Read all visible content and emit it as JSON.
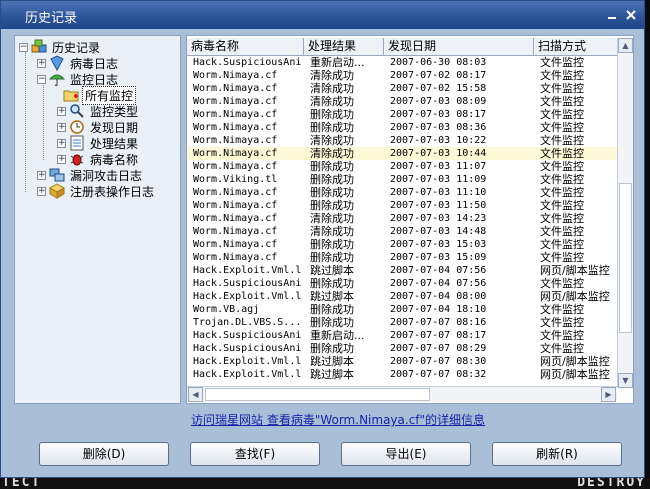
{
  "window": {
    "title": "历史记录"
  },
  "tree": {
    "root": "历史记录",
    "virus_log": "病毒日志",
    "monitor_log": "监控日志",
    "all_monitor": "所有监控",
    "monitor_type": "监控类型",
    "found_date": "发现日期",
    "result": "处理结果",
    "virus_name": "病毒名称",
    "exploit_log": "漏洞攻击日志",
    "registry_log": "注册表操作日志"
  },
  "table": {
    "columns": [
      "病毒名称",
      "处理结果",
      "发现日期",
      "扫描方式"
    ],
    "rows": [
      [
        "Hack.SuspiciousAni",
        "重新启动...",
        "2007-06-30 08:03",
        "文件监控"
      ],
      [
        "Worm.Nimaya.cf",
        "清除成功",
        "2007-07-02 08:17",
        "文件监控"
      ],
      [
        "Worm.Nimaya.cf",
        "清除成功",
        "2007-07-02 15:58",
        "文件监控"
      ],
      [
        "Worm.Nimaya.cf",
        "清除成功",
        "2007-07-03 08:09",
        "文件监控"
      ],
      [
        "Worm.Nimaya.cf",
        "删除成功",
        "2007-07-03 08:17",
        "文件监控"
      ],
      [
        "Worm.Nimaya.cf",
        "删除成功",
        "2007-07-03 08:36",
        "文件监控"
      ],
      [
        "Worm.Nimaya.cf",
        "清除成功",
        "2007-07-03 10:22",
        "文件监控"
      ],
      [
        "Worm.Nimaya.cf",
        "清除成功",
        "2007-07-03 10:44",
        "文件监控"
      ],
      [
        "Worm.Nimaya.cf",
        "删除成功",
        "2007-07-03 11:07",
        "文件监控"
      ],
      [
        "Worm.Viking.tl",
        "删除成功",
        "2007-07-03 11:09",
        "文件监控"
      ],
      [
        "Worm.Nimaya.cf",
        "删除成功",
        "2007-07-03 11:10",
        "文件监控"
      ],
      [
        "Worm.Nimaya.cf",
        "删除成功",
        "2007-07-03 11:50",
        "文件监控"
      ],
      [
        "Worm.Nimaya.cf",
        "清除成功",
        "2007-07-03 14:23",
        "文件监控"
      ],
      [
        "Worm.Nimaya.cf",
        "清除成功",
        "2007-07-03 14:48",
        "文件监控"
      ],
      [
        "Worm.Nimaya.cf",
        "删除成功",
        "2007-07-03 15:03",
        "文件监控"
      ],
      [
        "Worm.Nimaya.cf",
        "删除成功",
        "2007-07-03 15:09",
        "文件监控"
      ],
      [
        "Hack.Exploit.Vml.l",
        "跳过脚本",
        "2007-07-04 07:56",
        "网页/脚本监控"
      ],
      [
        "Hack.SuspiciousAni",
        "删除成功",
        "2007-07-04 07:56",
        "文件监控"
      ],
      [
        "Hack.Exploit.Vml.l",
        "跳过脚本",
        "2007-07-04 08:00",
        "网页/脚本监控"
      ],
      [
        "Worm.VB.agj",
        "删除成功",
        "2007-07-04 18:10",
        "文件监控"
      ],
      [
        "Trojan.DL.VBS.S...",
        "删除成功",
        "2007-07-07 08:16",
        "文件监控"
      ],
      [
        "Hack.SuspiciousAni",
        "重新启动...",
        "2007-07-07 08:17",
        "文件监控"
      ],
      [
        "Hack.SuspiciousAni",
        "删除成功",
        "2007-07-07 08:29",
        "文件监控"
      ],
      [
        "Hack.Exploit.Vml.l",
        "跳过脚本",
        "2007-07-07 08:30",
        "网页/脚本监控"
      ],
      [
        "Hack.Exploit.Vml.l",
        "跳过脚本",
        "2007-07-07 08:32",
        "网页/脚本监控"
      ]
    ],
    "highlight_row": 7
  },
  "link": {
    "text": "访问瑞星网站 查看病毒\"Worm.Nimaya.cf\"的详细信息"
  },
  "buttons": {
    "delete": "删除(D)",
    "find": "查找(F)",
    "export": "导出(E)",
    "refresh": "刷新(R)"
  },
  "background_text": {
    "left": "TECT",
    "right": "DESTROY"
  },
  "colors": {
    "titlebar": "#2b5398",
    "window_bg": "#a9bfd8",
    "link": "#1b22a8",
    "highlight": "#fdf9d6"
  }
}
